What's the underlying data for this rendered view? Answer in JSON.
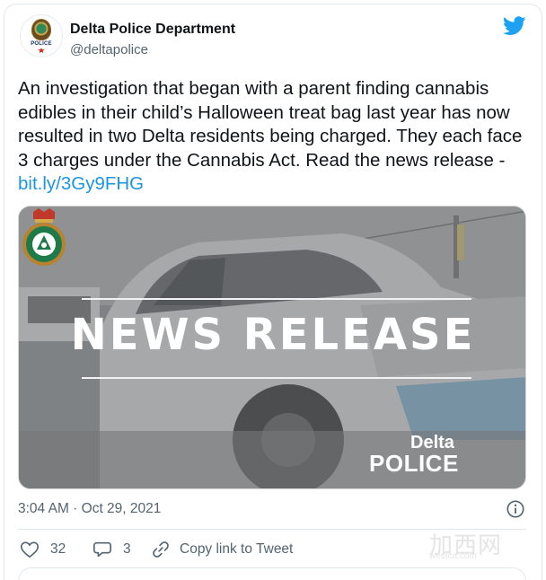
{
  "tweet": {
    "author": {
      "display_name": "Delta Police Department",
      "handle": "@deltapolice",
      "avatar_label": "POLICE"
    },
    "text": "An investigation that began with a parent finding cannabis edibles in their child’s Halloween treat bag last year has now resulted in two Delta residents being charged. They each face 3 charges under the Cannabis Act. Read the news release - ",
    "link_text": "bit.ly/3Gy9FHG",
    "media": {
      "headline": "NEWS RELEASE",
      "brand_line1": "Delta",
      "brand_line2": "POLICE"
    },
    "timestamp": "3:04 AM · Oct 29, 2021",
    "likes": "32",
    "replies": "3",
    "copy_link_label": "Copy link to Tweet"
  },
  "watermark": {
    "text": "加西网",
    "url": "westca.com"
  },
  "icons": {
    "brand": "twitter-bird-icon",
    "info": "info-icon",
    "like": "heart-icon",
    "reply": "reply-bubble-icon",
    "copy_link": "link-icon"
  },
  "colors": {
    "twitter_blue": "#1da1f2",
    "link": "#1b95e0",
    "secondary_text": "#536471",
    "like_icon": "#e0245e"
  }
}
